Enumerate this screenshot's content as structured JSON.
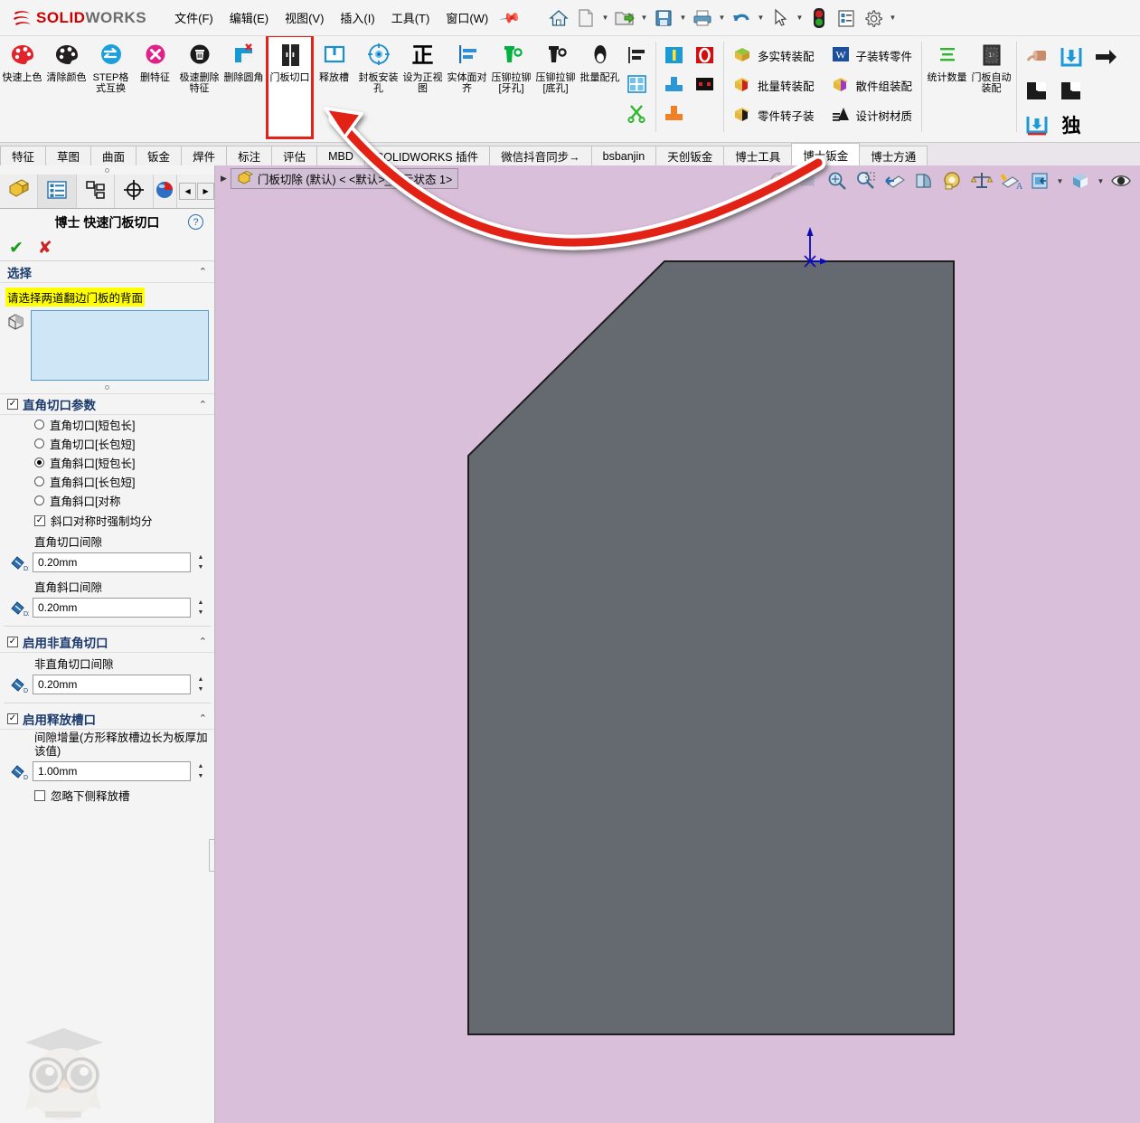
{
  "app": {
    "brand_ds": "⅔S",
    "brand_solid": "SOLID",
    "brand_works": "WORKS",
    "accent_red": "#cc0000",
    "highlight_red": "#e32219",
    "graphics_bg": "#d9bfd9",
    "model_color": "#646a6f"
  },
  "menubar": {
    "items": [
      {
        "label": "文件(F)"
      },
      {
        "label": "编辑(E)"
      },
      {
        "label": "视图(V)"
      },
      {
        "label": "插入(I)"
      },
      {
        "label": "工具(T)"
      },
      {
        "label": "窗口(W)"
      }
    ],
    "pin": "pin-icon",
    "quick_access": [
      {
        "name": "home-icon",
        "caret": false
      },
      {
        "name": "new-document-icon",
        "caret": true
      },
      {
        "name": "open-folder-icon",
        "caret": true
      },
      {
        "name": "save-icon",
        "caret": true
      },
      {
        "name": "print-icon",
        "caret": true
      },
      {
        "name": "undo-icon",
        "caret": true
      },
      {
        "name": "select-arrow-icon",
        "caret": true
      },
      {
        "name": "rebuild-traffic-light-icon",
        "caret": false
      },
      {
        "name": "options-list-icon",
        "caret": false
      },
      {
        "name": "settings-gear-icon",
        "caret": true
      }
    ]
  },
  "ribbon": {
    "big_buttons": [
      {
        "label": "快速上色",
        "icon": "red-palette-icon"
      },
      {
        "label": "清除颜色",
        "icon": "black-palette-icon"
      },
      {
        "label": "STEP格式互换",
        "icon": "blue-swap-icon"
      },
      {
        "label": "删特征",
        "icon": "pink-x-circle-icon"
      },
      {
        "label": "极速删除特征",
        "icon": "black-trash-icon"
      },
      {
        "label": "删除圆角",
        "icon": "blue-corner-x-icon"
      },
      {
        "label": "门板切口",
        "icon": "door-panel-cut-icon",
        "highlighted": true
      },
      {
        "label": "释放槽",
        "icon": "blue-book-icon"
      },
      {
        "label": "封板安装孔",
        "icon": "blue-target-icon"
      },
      {
        "label": "设为正视图",
        "icon": "zheng-char-icon"
      },
      {
        "label": "实体面对齐",
        "icon": "blue-align-icon"
      },
      {
        "label": "压铆拉铆[牙孔]",
        "icon": "green-rivet-icon"
      },
      {
        "label": "压铆拉铆[底孔]",
        "icon": "black-rivet-icon"
      },
      {
        "label": "批量配孔",
        "icon": "black-oval-hole-icon"
      }
    ],
    "small_group_1": [
      {
        "name": "align-bars-icon"
      },
      {
        "name": "blue-grid-icon"
      },
      {
        "name": "green-scissors-icon"
      }
    ],
    "small_group_2": [
      {
        "name": "blue-i-beam-icon"
      },
      {
        "name": "red-o-icon"
      },
      {
        "name": "blue-tee-icon"
      },
      {
        "name": "black-red-block-icon"
      },
      {
        "name": "orange-tee-icon"
      }
    ],
    "text_buttons_col1": [
      {
        "label": "多实转装配",
        "icon": "green-box-icon"
      },
      {
        "label": "批量转装配",
        "icon": "red-box-icon"
      },
      {
        "label": "零件转子装",
        "icon": "black-box-icon"
      }
    ],
    "text_buttons_col2": [
      {
        "label": "子装转零件",
        "icon": "blue-w-icon"
      },
      {
        "label": "散件组装配",
        "icon": "purple-box-icon"
      },
      {
        "label": "设计树材质",
        "icon": "tree-material-icon"
      }
    ],
    "big_buttons_right": [
      {
        "label": "统计数量",
        "icon": "green-lines-icon"
      },
      {
        "label": "门板自动装配",
        "icon": "dark-panel-icon"
      }
    ],
    "right_small": [
      {
        "name": "roller-icon"
      },
      {
        "name": "blue-insert-down-icon"
      },
      {
        "name": "black-right-arrow-icon"
      },
      {
        "name": "black-notch-left-icon"
      },
      {
        "name": "black-notch-right-icon"
      },
      {
        "name": "blue-insert-line-icon"
      },
      {
        "name": "du-char-icon"
      }
    ]
  },
  "tabs": {
    "items": [
      {
        "label": "特征",
        "active": false
      },
      {
        "label": "草图",
        "active": false
      },
      {
        "label": "曲面",
        "active": false
      },
      {
        "label": "钣金",
        "active": false
      },
      {
        "label": "焊件",
        "active": false
      },
      {
        "label": "标注",
        "active": false
      },
      {
        "label": "评估",
        "active": false
      },
      {
        "label": "MBD",
        "active": false
      },
      {
        "label": "SOLIDWORKS 插件",
        "active": false
      },
      {
        "label": "微信抖音同步→",
        "active": false
      },
      {
        "label": "bsbanjin",
        "active": false
      },
      {
        "label": "天创钣金",
        "active": false
      },
      {
        "label": "博士工具",
        "active": false
      },
      {
        "label": "博士钣金",
        "active": true
      },
      {
        "label": "博士方通",
        "active": false
      }
    ]
  },
  "property_manager": {
    "tabs": [
      {
        "name": "feature-tree-tab",
        "icon": "yellow-block-icon",
        "active": false
      },
      {
        "name": "property-manager-tab",
        "icon": "blue-list-icon",
        "active": true
      },
      {
        "name": "configuration-manager-tab",
        "icon": "config-tree-icon",
        "active": false
      },
      {
        "name": "dimxpert-tab",
        "icon": "crosshair-icon",
        "active": false
      },
      {
        "name": "display-manager-tab",
        "icon": "sphere-icon",
        "active": false
      }
    ],
    "nav_prev": "◀",
    "nav_next": "▶",
    "title": "博士 快速门板切口",
    "help_label": "?",
    "ok_label": "✔",
    "cancel_label": "✘",
    "selection": {
      "header": "选择",
      "prompt": "请选择两道翻边门板的背面",
      "box_value": ""
    },
    "right_angle": {
      "header": "直角切口参数",
      "checked": true,
      "options": [
        {
          "label": "直角切口[短包长]",
          "selected": false
        },
        {
          "label": "直角切口[长包短]",
          "selected": false
        },
        {
          "label": "直角斜口[短包长]",
          "selected": true
        },
        {
          "label": "直角斜口[长包短]",
          "selected": false
        },
        {
          "label": "直角斜口[对称",
          "selected": false
        }
      ],
      "symmetric_checkbox": {
        "label": "斜口对称时强制均分",
        "checked": true
      },
      "gap1_label": "直角切口间隙",
      "gap1_value": "0.20mm",
      "gap1_icon": "D1",
      "gap2_label": "直角斜口间隙",
      "gap2_value": "0.20mm",
      "gap2_icon": "D2"
    },
    "non_right_angle": {
      "header": "启用非直角切口",
      "checked": true,
      "gap_label": "非直角切口间隙",
      "gap_value": "0.20mm",
      "gap_icon": "D"
    },
    "relief": {
      "header": "启用释放槽口",
      "checked": true,
      "gap_label": "间隙增量(方形释放槽边长为板厚加该值)",
      "gap_value": "1.00mm",
      "gap_icon": "D",
      "ignore_checkbox": {
        "label": "忽略下侧释放槽",
        "checked": false
      }
    },
    "watermark": "owl-mascot-logo"
  },
  "graphics": {
    "expand_arrow": "▶",
    "document_label": "门板切除 (默认) < <默认>_显示状态 1>",
    "document_icon": "yellow-part-icon",
    "view_toolbar": [
      {
        "name": "previous-view-icon",
        "disabled": true,
        "caret": false
      },
      {
        "name": "section-view-icon",
        "disabled": true,
        "caret": false
      },
      {
        "name": "zoom-to-fit-icon",
        "disabled": false,
        "caret": false
      },
      {
        "name": "zoom-to-area-icon",
        "disabled": false,
        "caret": false
      },
      {
        "name": "rotate-view-icon",
        "disabled": false,
        "caret": false
      },
      {
        "name": "section-plane-icon",
        "disabled": false,
        "caret": false
      },
      {
        "name": "measure-icon",
        "disabled": false,
        "caret": false
      },
      {
        "name": "mass-properties-icon",
        "disabled": false,
        "caret": false
      },
      {
        "name": "appearance-icon",
        "disabled": false,
        "caret": false
      },
      {
        "name": "view-orientation-icon",
        "disabled": false,
        "caret": true
      },
      {
        "name": "display-style-icon",
        "disabled": false,
        "caret": true
      },
      {
        "name": "hide-show-eye-icon",
        "disabled": false,
        "caret": false
      }
    ],
    "origin_marker": "origin-triad-icon"
  },
  "annotation": {
    "arrow_name": "red-curved-callout-arrow",
    "arrow_color": "#e32219",
    "highlight_box_name": "red-highlight-box"
  }
}
